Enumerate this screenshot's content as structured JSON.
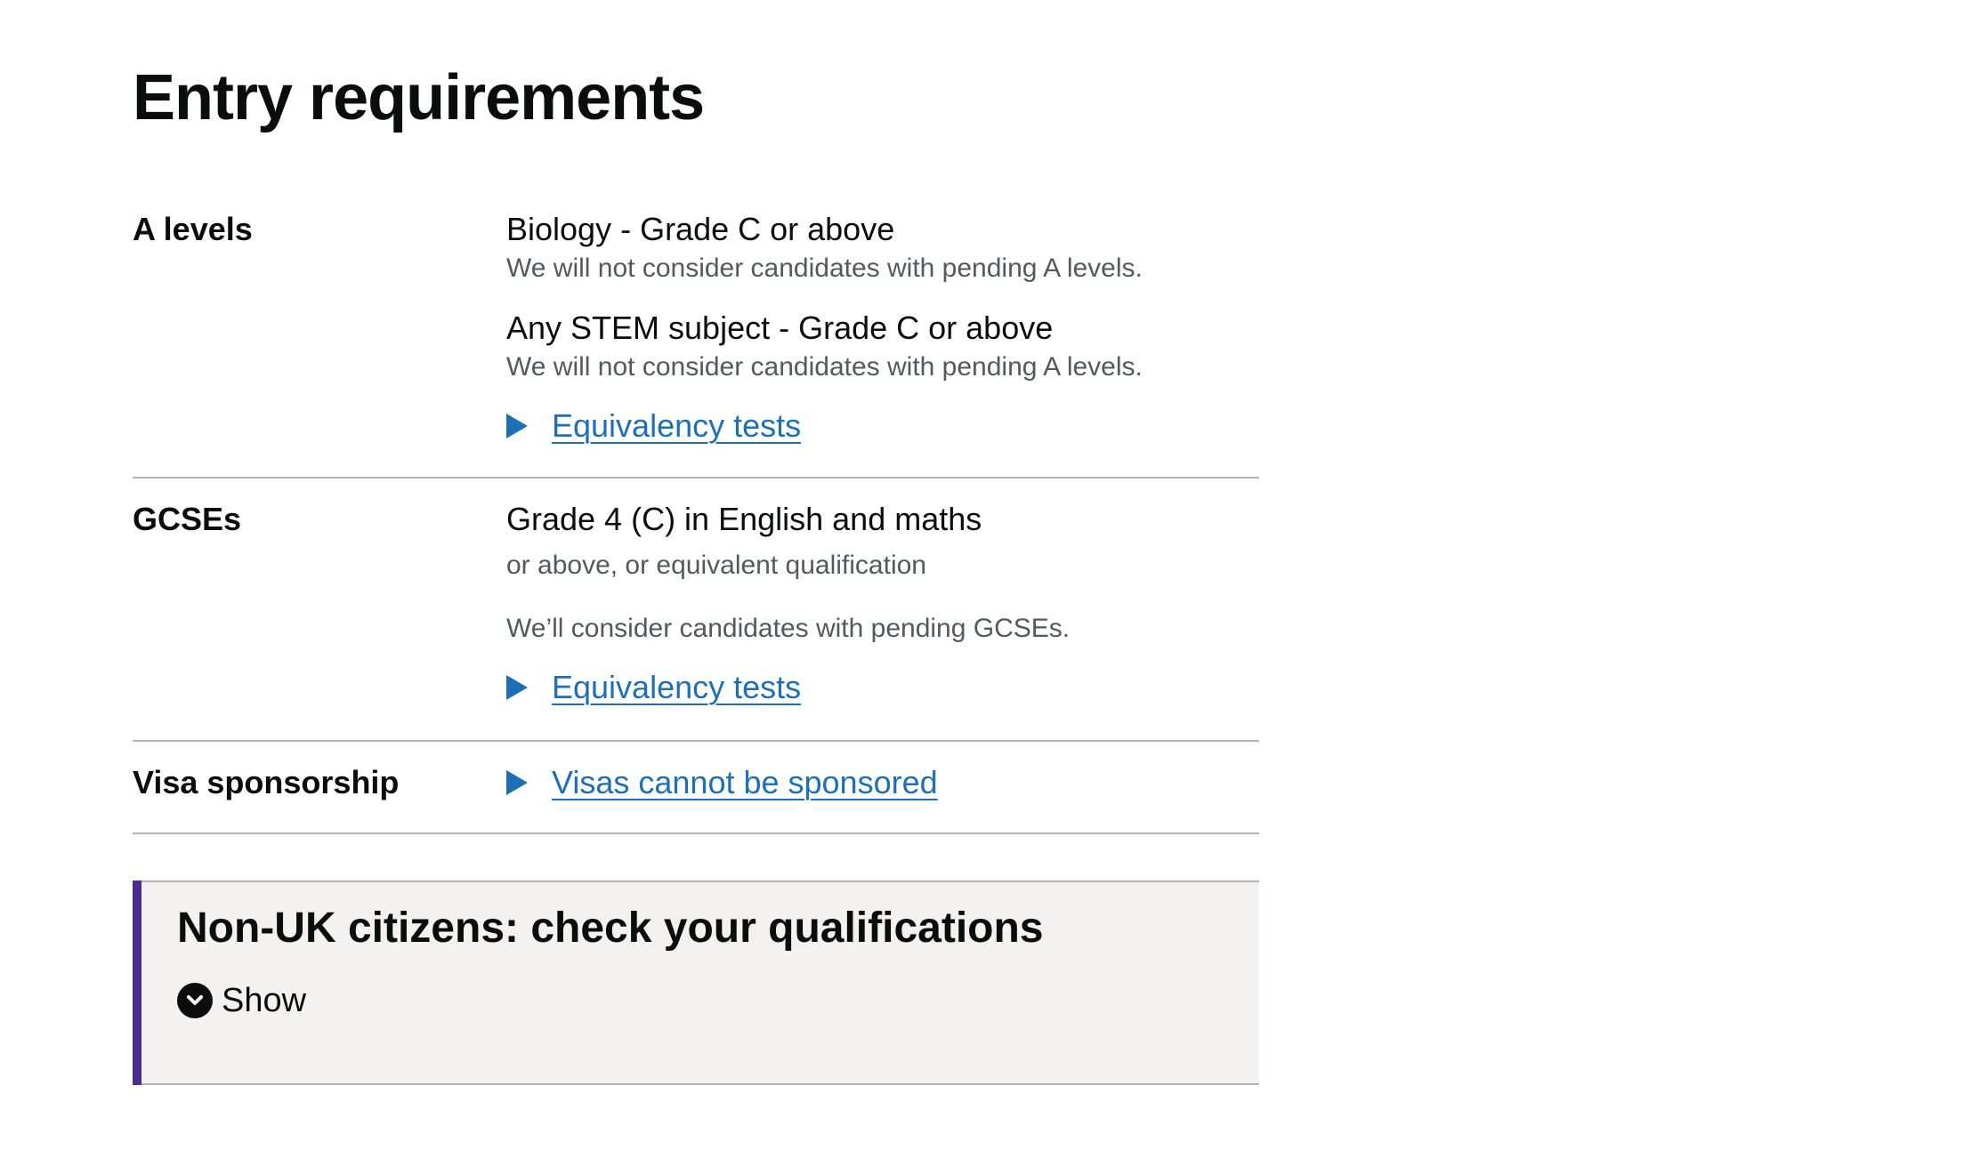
{
  "page": {
    "title": "Entry requirements"
  },
  "a_levels": {
    "label": "A levels",
    "requirements": [
      {
        "subject": "Biology - Grade C or above",
        "note": "We will not consider candidates with pending A levels."
      },
      {
        "subject": "Any STEM subject - Grade C or above",
        "note": "We will not consider candidates with pending A levels."
      }
    ],
    "details_label": "Equivalency tests"
  },
  "gcses": {
    "label": "GCSEs",
    "requirement": "Grade 4 (C) in English and maths",
    "requirement_suffix": "or above, or equivalent qualification",
    "pending_note": "We’ll consider candidates with pending GCSEs.",
    "details_label": "Equivalency tests"
  },
  "visa": {
    "label": "Visa sponsorship",
    "details_label": "Visas cannot be sponsored"
  },
  "notice": {
    "title": "Non-UK citizens: check your qualifications",
    "toggle_label": "Show"
  },
  "colors": {
    "link": "#1d70b8",
    "text": "#0b0c0c",
    "secondary_text": "#505a5f",
    "border": "#b1b4b6",
    "notice_background": "#f3f2f1",
    "notice_accent": "#4c2c92"
  },
  "icons": {
    "details_toggle": "triangle-right-icon",
    "show_toggle": "chevron-down-circle-icon"
  }
}
